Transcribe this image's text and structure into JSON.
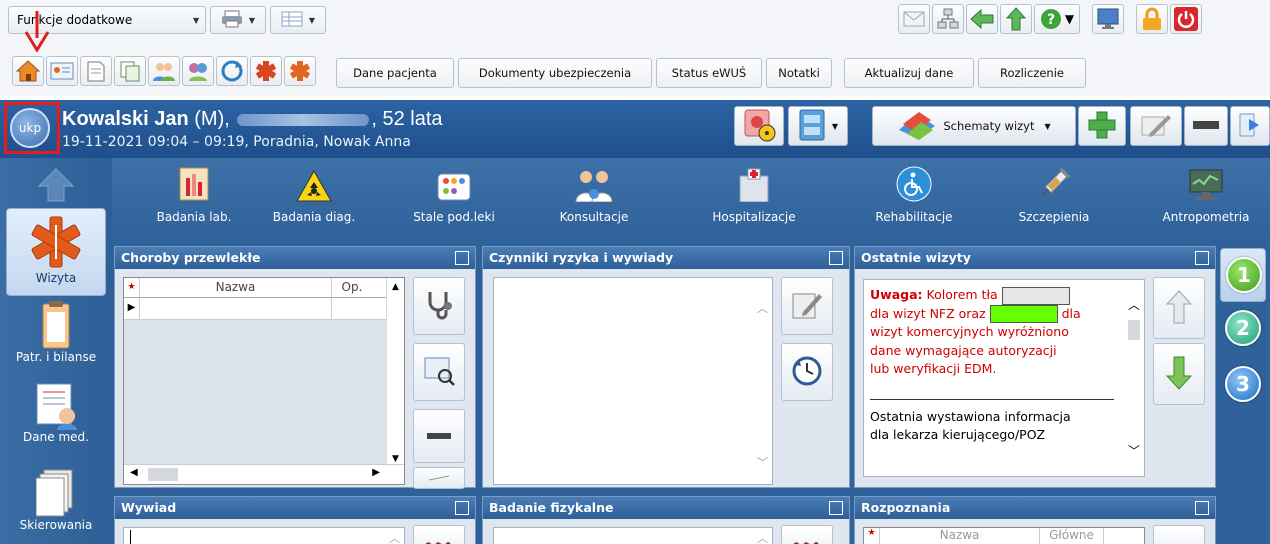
{
  "toolbar": {
    "functions_dropdown": "Funkcje dodatkowe",
    "buttons": [
      "Dane pacjenta",
      "Dokumenty ubezpieczenia",
      "Status eWUŚ",
      "Notatki",
      "Aktualizuj dane",
      "Rozliczenie"
    ]
  },
  "patient": {
    "name": "Kowalski Jan",
    "sex": " (M),",
    "age": ", 52 lata",
    "visit": "19-11-2021 09:04 – 09:19, Poradnia, Nowak Anna",
    "logo_text": "ukp"
  },
  "header_buttons": {
    "schemes": "Schematy wizyt"
  },
  "nav": [
    {
      "label": "Wizyta"
    },
    {
      "label": "Patr. i bilanse"
    },
    {
      "label": "Dane med."
    },
    {
      "label": "Skierowania"
    }
  ],
  "tools": [
    {
      "label": "Badania lab.",
      "icon": "lab-tests-icon"
    },
    {
      "label": "Badania diag.",
      "icon": "radiation-icon"
    },
    {
      "label": "Stale pod.leki",
      "icon": "medicines-icon"
    },
    {
      "label": "Konsultacje",
      "icon": "consultations-icon"
    },
    {
      "label": "Hospitalizacje",
      "icon": "hospital-icon"
    },
    {
      "label": "Rehabilitacje",
      "icon": "wheelchair-icon"
    },
    {
      "label": "Szczepienia",
      "icon": "syringe-icon"
    },
    {
      "label": "Antropometria",
      "icon": "monitor-icon"
    }
  ],
  "panels": {
    "chronic": {
      "title": "Choroby przewlekłe",
      "col_star": "★",
      "col_name": "Nazwa",
      "col_op": "Op."
    },
    "risk": {
      "title": "Czynniki ryzyka i wywiady"
    },
    "visits": {
      "title": "Ostatnie wizyty",
      "note_bold": "Uwaga:",
      "note_1": "Kolorem tła",
      "note_2": "dla wizyt NFZ oraz",
      "note_3": "dla",
      "note_4": "wizyt komercyjnych wyróżniono",
      "note_5": "dane wymagające autoryzacji",
      "note_6": "lub weryfikacji EDM.",
      "info_1": "Ostatnia wystawiona informacja",
      "info_2": "dla lekarza kierującego/POZ"
    },
    "interview": {
      "title": "Wywiad"
    },
    "physical": {
      "title": "Badanie fizykalne"
    },
    "diagnoses": {
      "title": "Rozpoznania",
      "col_name": "Nazwa",
      "col_main": "Główne"
    }
  },
  "numbers": [
    "1",
    "2",
    "3"
  ],
  "colors": {
    "nfz": "#e6e6e6",
    "commercial": "#66ff00",
    "accent": "#2e5f97"
  }
}
